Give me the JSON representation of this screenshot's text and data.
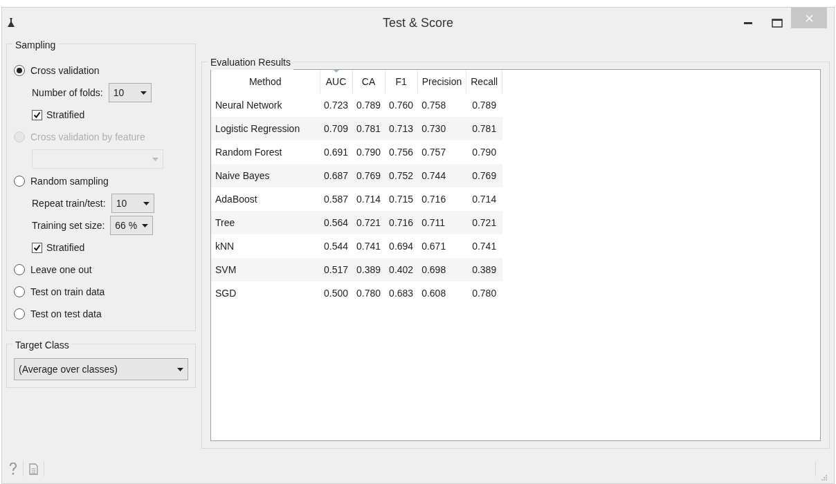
{
  "window": {
    "title": "Test & Score"
  },
  "sampling": {
    "title": "Sampling",
    "options": [
      {
        "kind": "radio",
        "label": "Cross validation",
        "selected": true,
        "disabled": false,
        "children": [
          {
            "kind": "select",
            "label": "Number of folds:",
            "value": "10",
            "disabled": false
          },
          {
            "kind": "checkbox",
            "label": "Stratified",
            "checked": true
          }
        ]
      },
      {
        "kind": "radio",
        "label": "Cross validation by feature",
        "selected": false,
        "disabled": true,
        "children": [
          {
            "kind": "select",
            "disabled": true
          }
        ]
      },
      {
        "kind": "radio",
        "label": "Random sampling",
        "selected": false,
        "disabled": false,
        "children": [
          {
            "kind": "select",
            "label": "Repeat train/test:",
            "value": "10",
            "disabled": false
          },
          {
            "kind": "select",
            "label": "Training set size:",
            "value": "66 %",
            "disabled": false
          },
          {
            "kind": "checkbox",
            "label": "Stratified",
            "checked": true
          }
        ]
      },
      {
        "kind": "radio",
        "label": "Leave one out",
        "selected": false,
        "disabled": false
      },
      {
        "kind": "radio",
        "label": "Test on train data",
        "selected": false,
        "disabled": false
      },
      {
        "kind": "radio",
        "label": "Test on test data",
        "selected": false,
        "disabled": false
      }
    ]
  },
  "target_class": {
    "title": "Target Class",
    "value": "(Average over classes)"
  },
  "evaluation_results": {
    "title": "Evaluation Results",
    "columns": [
      {
        "label": "Method",
        "sorted": false
      },
      {
        "label": "AUC",
        "sorted": true
      },
      {
        "label": "CA",
        "sorted": false
      },
      {
        "label": "F1",
        "sorted": false
      },
      {
        "label": "Precision",
        "sorted": false
      },
      {
        "label": "Recall",
        "sorted": false
      }
    ],
    "rows": [
      [
        "Neural Network",
        "0.723",
        "0.789",
        "0.760",
        "0.758",
        "0.789"
      ],
      [
        "Logistic Regression",
        "0.709",
        "0.781",
        "0.713",
        "0.730",
        "0.781"
      ],
      [
        "Random Forest",
        "0.691",
        "0.790",
        "0.756",
        "0.757",
        "0.790"
      ],
      [
        "Naive Bayes",
        "0.687",
        "0.769",
        "0.752",
        "0.744",
        "0.769"
      ],
      [
        "AdaBoost",
        "0.587",
        "0.714",
        "0.715",
        "0.716",
        "0.714"
      ],
      [
        "Tree",
        "0.564",
        "0.721",
        "0.716",
        "0.711",
        "0.721"
      ],
      [
        "kNN",
        "0.544",
        "0.741",
        "0.694",
        "0.671",
        "0.741"
      ],
      [
        "SVM",
        "0.517",
        "0.389",
        "0.402",
        "0.698",
        "0.389"
      ],
      [
        "SGD",
        "0.500",
        "0.780",
        "0.683",
        "0.608",
        "0.780"
      ]
    ]
  }
}
